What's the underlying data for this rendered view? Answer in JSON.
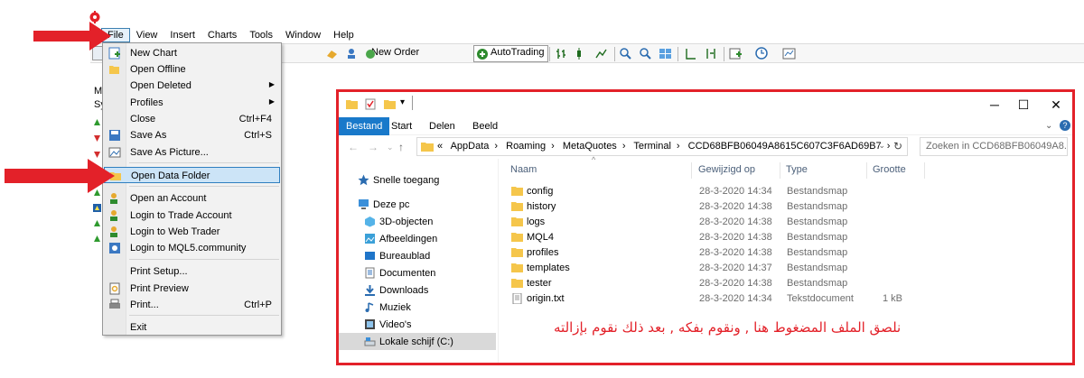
{
  "menubar": [
    "File",
    "View",
    "Insert",
    "Charts",
    "Tools",
    "Window",
    "Help"
  ],
  "toolbar": {
    "new_order": "New Order",
    "autotrading": "AutoTrading"
  },
  "left_panel": {
    "title": "Ma",
    "label": "Sy"
  },
  "file_menu": [
    {
      "label": "New Chart",
      "shortcut": "",
      "icon": "new-chart-icon"
    },
    {
      "label": "Open Offline",
      "shortcut": "",
      "icon": "folder-open-icon"
    },
    {
      "label": "Open Deleted",
      "shortcut": "",
      "submenu": true
    },
    {
      "label": "Profiles",
      "shortcut": "",
      "submenu": true
    },
    {
      "label": "Close",
      "shortcut": "Ctrl+F4"
    },
    {
      "label": "Save As",
      "shortcut": "Ctrl+S",
      "icon": "save-icon"
    },
    {
      "label": "Save As Picture...",
      "shortcut": "",
      "icon": "picture-icon"
    },
    {
      "label": "Open Data Folder",
      "shortcut": "",
      "icon": "folder-icon",
      "highlighted": true
    },
    {
      "label": "Open an Account",
      "shortcut": "",
      "icon": "account-icon"
    },
    {
      "label": "Login to Trade Account",
      "shortcut": "",
      "icon": "login-icon"
    },
    {
      "label": "Login to Web Trader",
      "shortcut": "",
      "icon": "login-icon"
    },
    {
      "label": "Login to MQL5.community",
      "shortcut": "",
      "icon": "mql5-icon"
    },
    {
      "label": "Print Setup...",
      "shortcut": ""
    },
    {
      "label": "Print Preview",
      "shortcut": "",
      "icon": "print-preview-icon"
    },
    {
      "label": "Print...",
      "shortcut": "Ctrl+P",
      "icon": "printer-icon"
    },
    {
      "label": "Exit",
      "shortcut": ""
    }
  ],
  "explorer": {
    "ribbon_tabs": [
      "Bestand",
      "Start",
      "Delen",
      "Beeld"
    ],
    "breadcrumb_prefix": "«",
    "breadcrumbs": [
      "AppData",
      "Roaming",
      "MetaQuotes",
      "Terminal",
      "CCD68BFB06049A8615C607C3F6AD69B7"
    ],
    "search_placeholder": "Zoeken in CCD68BFB06049A8...",
    "nav": [
      {
        "label": "Snelle toegang",
        "icon": "star-icon"
      },
      {
        "label": "Deze pc",
        "icon": "computer-icon"
      },
      {
        "label": "3D-objecten",
        "icon": "cube-icon"
      },
      {
        "label": "Afbeeldingen",
        "icon": "pictures-icon"
      },
      {
        "label": "Bureaublad",
        "icon": "desktop-icon"
      },
      {
        "label": "Documenten",
        "icon": "documents-icon"
      },
      {
        "label": "Downloads",
        "icon": "download-icon"
      },
      {
        "label": "Muziek",
        "icon": "music-icon"
      },
      {
        "label": "Video's",
        "icon": "video-icon"
      },
      {
        "label": "Lokale schijf (C:)",
        "icon": "drive-icon",
        "selected": true
      }
    ],
    "columns": [
      "Naam",
      "Gewijzigd op",
      "Type",
      "Grootte"
    ],
    "files": [
      {
        "name": "config",
        "date": "28-3-2020 14:34",
        "type": "Bestandsmap",
        "size": ""
      },
      {
        "name": "history",
        "date": "28-3-2020 14:38",
        "type": "Bestandsmap",
        "size": ""
      },
      {
        "name": "logs",
        "date": "28-3-2020 14:38",
        "type": "Bestandsmap",
        "size": ""
      },
      {
        "name": "MQL4",
        "date": "28-3-2020 14:38",
        "type": "Bestandsmap",
        "size": ""
      },
      {
        "name": "profiles",
        "date": "28-3-2020 14:38",
        "type": "Bestandsmap",
        "size": ""
      },
      {
        "name": "templates",
        "date": "28-3-2020 14:37",
        "type": "Bestandsmap",
        "size": ""
      },
      {
        "name": "tester",
        "date": "28-3-2020 14:38",
        "type": "Bestandsmap",
        "size": ""
      },
      {
        "name": "origin.txt",
        "date": "28-3-2020 14:34",
        "type": "Tekstdocument",
        "size": "1 kB"
      }
    ],
    "annotation": "نلصق الملف المضغوط هنا , ونقوم بفكه , بعد ذلك نقوم بإزالته"
  },
  "colors": {
    "annotation": "#e32129",
    "ribbon_active": "#1979ca",
    "folder": "#f5c64b",
    "menu_highlight": "#cce4f7"
  }
}
